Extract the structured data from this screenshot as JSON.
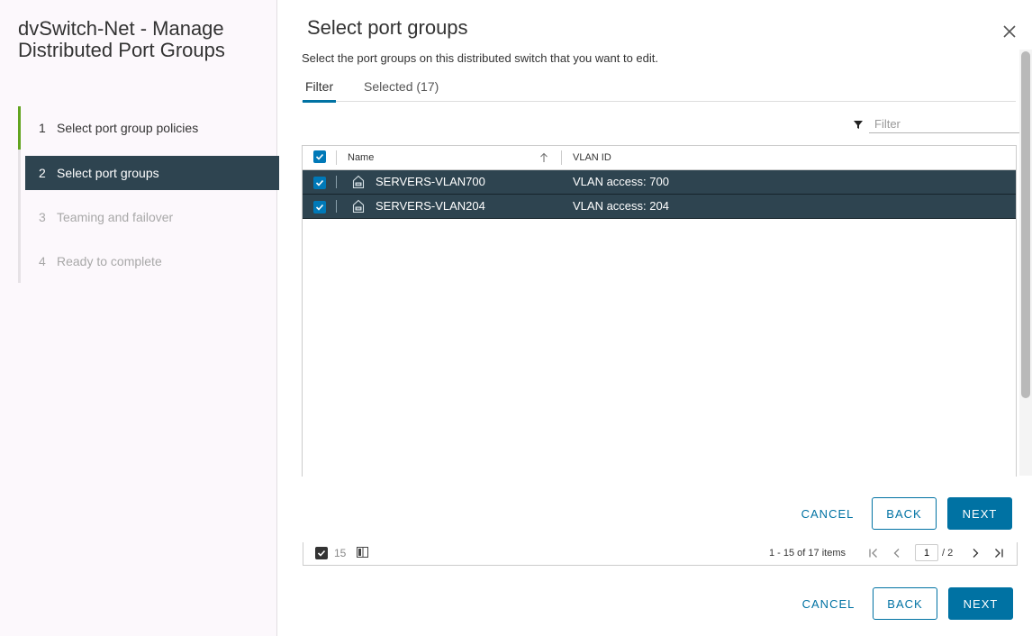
{
  "wizard": {
    "title": "dvSwitch-Net - Manage Distributed Port Groups",
    "steps": [
      {
        "num": "1",
        "label": "Select port group policies"
      },
      {
        "num": "2",
        "label": "Select port groups"
      },
      {
        "num": "3",
        "label": "Teaming and failover"
      },
      {
        "num": "4",
        "label": "Ready to complete"
      }
    ],
    "accent": "#62a420",
    "active_bg": "#2e4450"
  },
  "main": {
    "title": "Select port groups",
    "subtitle": "Select the port groups on this distributed switch that you want to edit.",
    "tabs": [
      {
        "label": "Filter"
      },
      {
        "label": "Selected (17)"
      }
    ],
    "filter_placeholder": "Filter",
    "grid": {
      "columns": [
        "Name",
        "VLAN ID"
      ],
      "rows": [
        {
          "name": "SERVERS-VLAN700",
          "vlan": "VLAN access: 700"
        },
        {
          "name": "SERVERS-VLAN204",
          "vlan": "VLAN access: 204"
        }
      ]
    },
    "footer": {
      "selected_count": "15",
      "items_label": "1 - 15 of 17 items",
      "page": "1",
      "page_total": "/ 2"
    },
    "buttons_inner": {
      "cancel": "CANCEL",
      "back": "BACK",
      "next": "NEXT"
    },
    "buttons_outer": {
      "cancel": "CANCEL",
      "back": "BACK",
      "next": "NEXT"
    }
  },
  "colors": {
    "primary": "#0072a3",
    "row_selected": "#2e4450"
  },
  "icons": [
    "close-icon",
    "filter-icon",
    "sort-up-icon",
    "portgroup-icon",
    "column-toggle-icon",
    "first-page-icon",
    "prev-page-icon",
    "next-page-icon",
    "last-page-icon"
  ]
}
